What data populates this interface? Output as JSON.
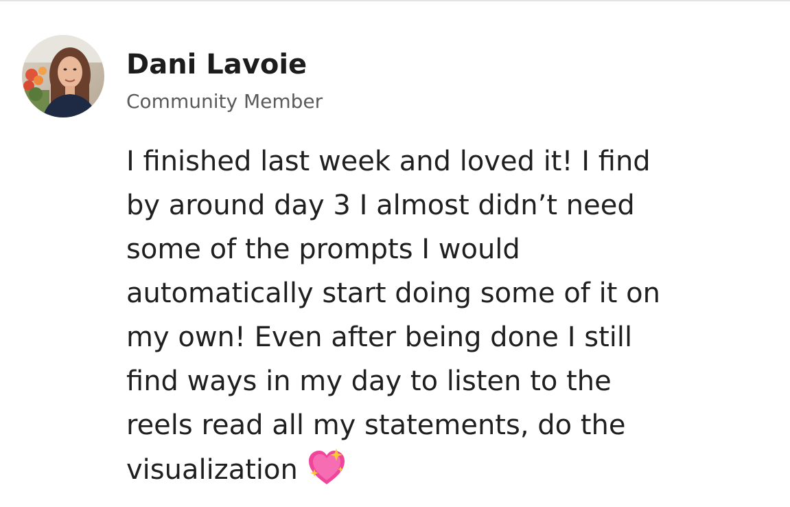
{
  "author": {
    "name": "Dani Lavoie",
    "role": "Community Member"
  },
  "comment": {
    "lines": [
      "I finished last week and loved it! I find",
      "by around day 3 I almost didn’t need",
      "some of the prompts I would",
      "automatically start doing some of it on",
      "my own! Even after being done I still",
      "find ways in my day to listen to the",
      "reels read all my statements, do the",
      "visualization"
    ],
    "emoji": "sparkling-heart-emoji"
  },
  "colors": {
    "text": "#1f1f1f",
    "role_text": "#5a5a5a",
    "divider": "#e3e3e3",
    "heart": "#f0459a",
    "sparkle": "#f7c934"
  }
}
